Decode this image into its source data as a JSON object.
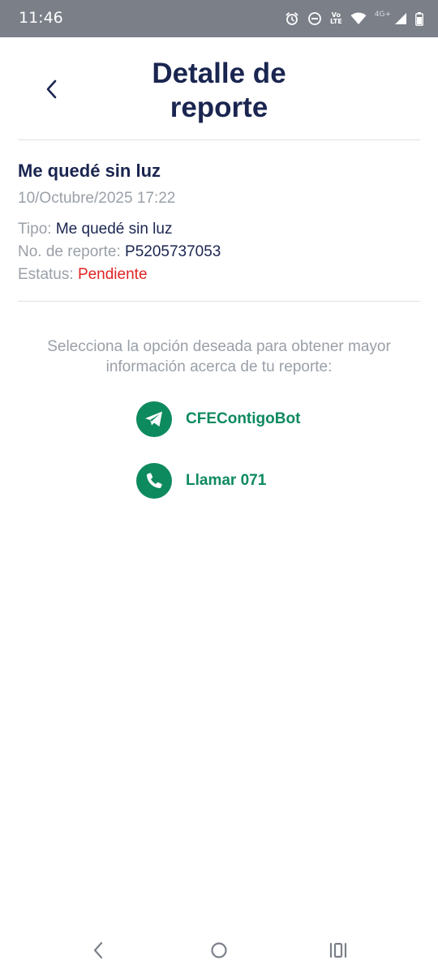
{
  "status_bar": {
    "time": "11:46",
    "lte_top": "Vo",
    "lte_bottom": "LTE",
    "network": "4G+"
  },
  "header": {
    "title": "Detalle de reporte",
    "back_icon": "chevron-left-icon"
  },
  "report": {
    "title": "Me quedé sin luz",
    "date": "10/Octubre/2025 17:22",
    "tipo_label": "Tipo:",
    "tipo_value": "Me quedé sin luz",
    "numero_label": "No. de reporte:",
    "numero_value": "P5205737053",
    "estatus_label": "Estatus:",
    "estatus_value": "Pendiente"
  },
  "options": {
    "instruction": "Selecciona la opción deseada para obtener mayor información acerca de tu reporte:",
    "bot_label": "CFEContigoBot",
    "bot_icon": "telegram-icon",
    "call_label": "Llamar 071",
    "call_icon": "phone-icon"
  },
  "colors": {
    "primary": "#1a2550",
    "accent_green": "#0e8a5f",
    "status_red": "#e02424",
    "muted": "#9aa0a8",
    "status_bar_bg": "#7a7f88"
  }
}
